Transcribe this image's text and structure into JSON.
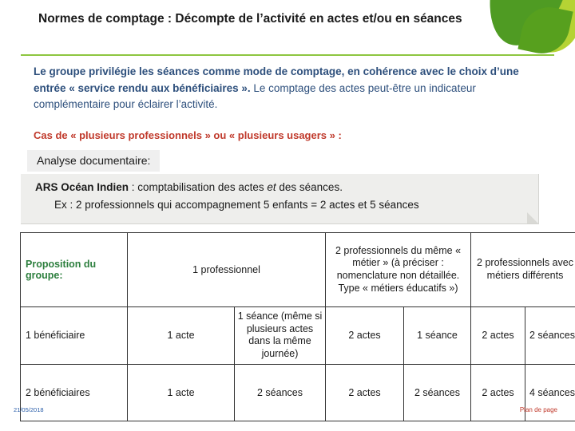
{
  "slide": {
    "title": "Normes de comptage : Décompte de l’activité en actes et/ou en séances",
    "intro_bold": "Le groupe privilégie les séances comme mode de comptage, en cohérence avec le choix d’une entrée « service rendu aux bénéficiaires ».",
    "intro_rest": " Le comptage des actes peut-être un indicateur complémentaire pour éclairer l’activité.",
    "subtitle_red": "Cas de « plusieurs professionnels » ou « plusieurs usagers » :",
    "analyse_label": "Analyse documentaire:",
    "example_source": "ARS Océan Indien",
    "example_text_1": " : comptabilisation des actes ",
    "example_text_italic": "et",
    "example_text_2": " des séances.",
    "example_line2": "Ex : 2 professionnels qui accompagnement 5 enfants = 2 actes et 5 séances"
  },
  "table": {
    "header": {
      "proposition_label": "Proposition du groupe:",
      "col_1_professionnel": "1 professionnel",
      "col_2_meme_metier": "2 professionnels du même « métier » (à préciser : nomenclature non détaillée. Type « métiers éducatifs »)",
      "col_2_metiers_diff": "2 professionnels avec métiers différents"
    },
    "rows": [
      {
        "label": "1 bénéficiaire",
        "c1": "1 acte",
        "c2": "1 séance (même si plusieurs actes dans la même journée)",
        "c3": "2 actes",
        "c4": "1 séance",
        "c5": "2 actes",
        "c6": "2 séances"
      },
      {
        "label": "2 bénéficiaires",
        "c1": "1 acte",
        "c2": "2 séances",
        "c3": "2 actes",
        "c4": "2 séances",
        "c5": "2 actes",
        "c6": "4 séances"
      }
    ]
  },
  "footer": {
    "date": "21/05/2018",
    "link": "Plan de page"
  }
}
